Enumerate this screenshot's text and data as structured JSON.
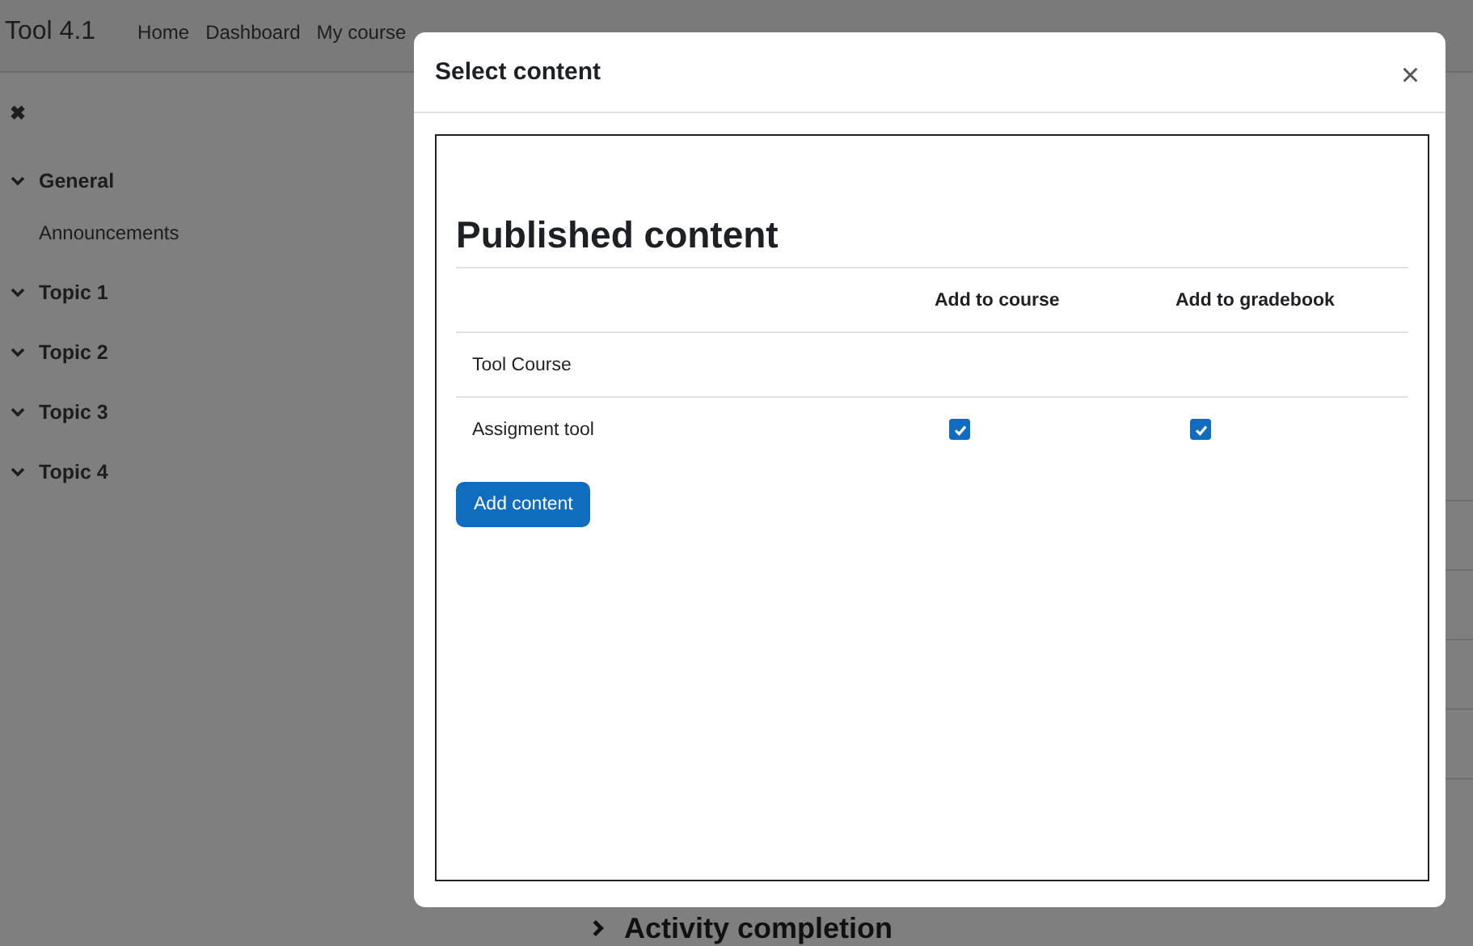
{
  "navbar": {
    "brand": "Tool 4.1",
    "links": [
      "Home",
      "Dashboard",
      "My course"
    ]
  },
  "drawer": {
    "close": "✖",
    "sections": [
      {
        "title": "General",
        "expanded": true,
        "children": [
          {
            "title": "Announcements"
          }
        ]
      },
      {
        "title": "Topic 1",
        "expanded": true
      },
      {
        "title": "Topic 2",
        "expanded": true
      },
      {
        "title": "Topic 3",
        "expanded": true
      },
      {
        "title": "Topic 4",
        "expanded": true
      }
    ]
  },
  "main": {
    "section_title": "Activity completion",
    "expanded": false
  },
  "modal": {
    "title": "Select content",
    "close": "×",
    "heading": "Published content",
    "columns": [
      "Add to course",
      "Add to gradebook"
    ],
    "rows": [
      {
        "name": "Tool Course",
        "kind": "course"
      },
      {
        "name": "Assigment tool",
        "kind": "activity",
        "add_to_course": true,
        "add_to_gradebook": true
      }
    ],
    "button": "Add content"
  }
}
